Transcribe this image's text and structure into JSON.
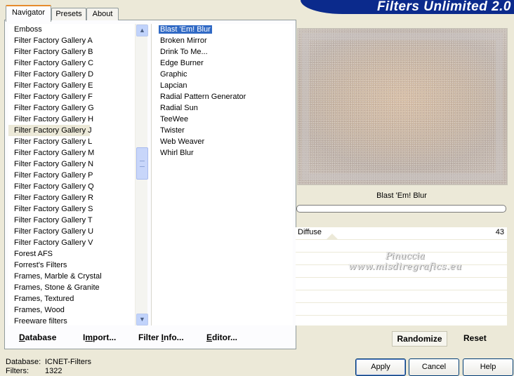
{
  "header": {
    "title": "Filters Unlimited 2.0"
  },
  "tabs": [
    {
      "label": "Navigator",
      "active": true
    },
    {
      "label": "Presets",
      "active": false
    },
    {
      "label": "About",
      "active": false
    }
  ],
  "categories": {
    "items": [
      "Emboss",
      "Filter Factory Gallery A",
      "Filter Factory Gallery B",
      "Filter Factory Gallery C",
      "Filter Factory Gallery D",
      "Filter Factory Gallery E",
      "Filter Factory Gallery F",
      "Filter Factory Gallery G",
      "Filter Factory Gallery H",
      "Filter Factory Gallery J",
      "Filter Factory Gallery L",
      "Filter Factory Gallery M",
      "Filter Factory Gallery N",
      "Filter Factory Gallery P",
      "Filter Factory Gallery Q",
      "Filter Factory Gallery R",
      "Filter Factory Gallery S",
      "Filter Factory Gallery T",
      "Filter Factory Gallery U",
      "Filter Factory Gallery V",
      "Forest AFS",
      "Forrest's Filters",
      "Frames, Marble & Crystal",
      "Frames, Stone & Granite",
      "Frames, Textured",
      "Frames, Wood",
      "Freeware filters"
    ],
    "selected": "Filter Factory Gallery J"
  },
  "filters": {
    "items": [
      "Blast 'Em! Blur",
      "Broken Mirror",
      "Drink To Me...",
      "Edge Burner",
      "Graphic",
      "Lapcian",
      "Radial Pattern Generator",
      "Radial Sun",
      "TeeWee",
      "Twister",
      "Web Weaver",
      "Whirl Blur"
    ],
    "selected": "Blast 'Em! Blur"
  },
  "bottom_left": {
    "database": {
      "underline": "D",
      "rest": "atabase"
    },
    "import": {
      "pre": "I",
      "u": "m",
      "rest": "port..."
    },
    "filter_info": {
      "pre": "Filter ",
      "u": "I",
      "rest": "nfo..."
    },
    "editor": {
      "u": "E",
      "rest": "ditor..."
    }
  },
  "preview": {
    "filter_name": "Blast 'Em! Blur",
    "progress": 0
  },
  "controls": {
    "sliders": [
      {
        "label": "Diffuse",
        "value": "43"
      }
    ],
    "watermark_line1": "Pinuccia",
    "watermark_line2": "www.misdiregrafics.eu",
    "randomize_label": "Randomize",
    "reset_label": "Reset"
  },
  "status": {
    "database_label": "Database:",
    "database_value": "ICNET-Filters",
    "filters_label": "Filters:",
    "filters_value": "1322"
  },
  "dialog": {
    "apply_label": "Apply",
    "cancel_label": "Cancel",
    "help_label": "Help"
  },
  "colors": {
    "banner": "#0b2a8c",
    "selection": "#316ac5",
    "tab_accent": "#e68b2c",
    "dialog_bg": "#ece9d8"
  }
}
